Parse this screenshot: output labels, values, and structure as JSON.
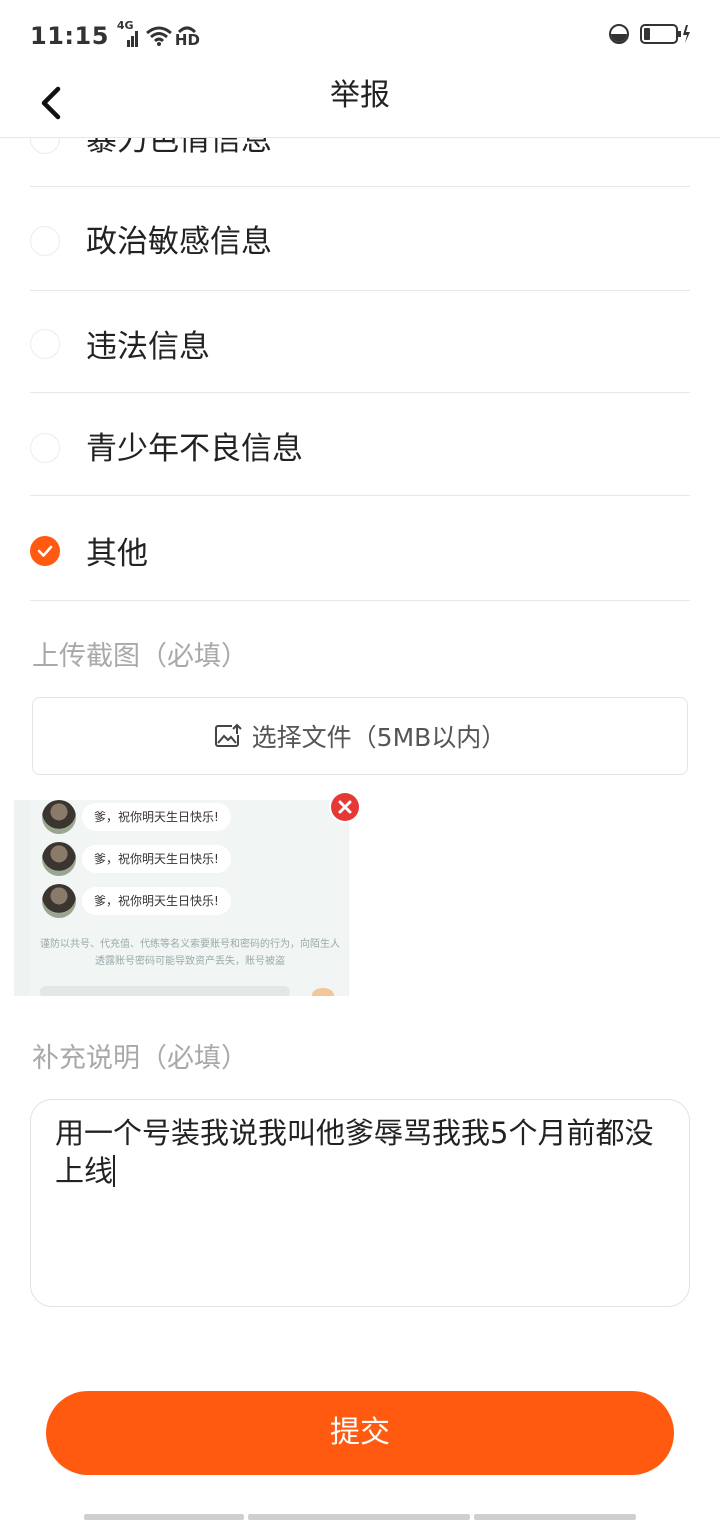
{
  "status_bar": {
    "time": "11:15",
    "network": "4G",
    "hd": "HD"
  },
  "header": {
    "title": "举报"
  },
  "options": [
    {
      "label": "暴力色情信息",
      "checked": false
    },
    {
      "label": "政治敏感信息",
      "checked": false
    },
    {
      "label": "违法信息",
      "checked": false
    },
    {
      "label": "青少年不良信息",
      "checked": false
    },
    {
      "label": "其他",
      "checked": true
    }
  ],
  "upload": {
    "label": "上传截图（必填）",
    "button_text": "选择文件（5MB以内）"
  },
  "screenshot": {
    "messages": [
      "爹，祝你明天生日快乐!",
      "爹，祝你明天生日快乐!",
      "爹，祝你明天生日快乐!"
    ],
    "notice": "谨防以共号、代充值、代练等名义索要账号和密码的行为，向陌生人透露账号密码可能导致资产丢失，账号被盗"
  },
  "description": {
    "label": "补充说明（必填）",
    "value": "用一个号装我说我叫他爹辱骂我我5个月前都没上线"
  },
  "submit": {
    "label": "提交"
  },
  "colors": {
    "accent": "#ff5a0f",
    "close": "#e53935"
  }
}
